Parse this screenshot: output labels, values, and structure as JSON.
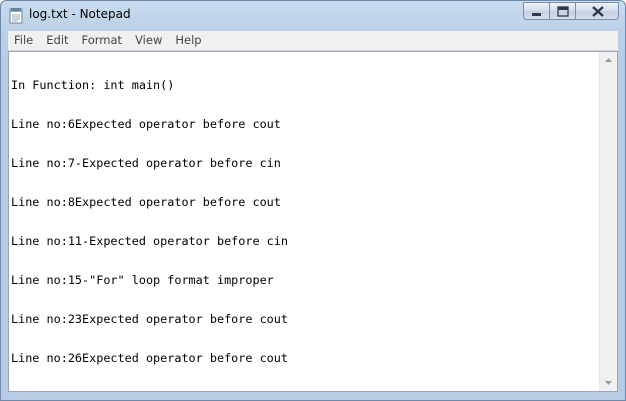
{
  "window": {
    "title": "log.txt - Notepad"
  },
  "menu": {
    "items": [
      "File",
      "Edit",
      "Format",
      "View",
      "Help"
    ]
  },
  "editor": {
    "lines": [
      "In Function: int main()",
      "Line no:6Expected operator before cout",
      "Line no:7-Expected operator before cin",
      "Line no:8Expected operator before cout",
      "Line no:11-Expected operator before cin",
      "Line no:15-\"For\" loop format improper",
      "Line no:23Expected operator before cout",
      "Line no:26Expected operator before cout"
    ]
  },
  "icons": {
    "app": "notepad-icon",
    "minimize": "minimize-icon",
    "maximize": "maximize-icon",
    "close": "close-icon",
    "scroll_up": "arrow-up-icon",
    "scroll_down": "arrow-down-icon"
  }
}
